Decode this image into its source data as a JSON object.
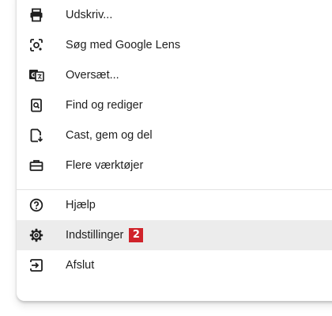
{
  "menu": {
    "top_items": [
      {
        "label": "Udskriv...",
        "icon": "print-icon"
      },
      {
        "label": "Søg med Google Lens",
        "icon": "google-lens-icon"
      },
      {
        "label": "Oversæt...",
        "icon": "translate-icon"
      },
      {
        "label": "Find og rediger",
        "icon": "find-edit-icon"
      },
      {
        "label": "Cast, gem og del",
        "icon": "cast-save-share-icon"
      },
      {
        "label": "Flere værktøjer",
        "icon": "toolbox-icon"
      }
    ],
    "bottom_items": [
      {
        "label": "Hjælp",
        "icon": "help-icon"
      },
      {
        "label": "Indstillinger",
        "icon": "gear-icon",
        "highlighted": true
      },
      {
        "label": "Afslut",
        "icon": "exit-icon"
      }
    ],
    "badge": "2",
    "badge_color": "#d0232b",
    "hover_color": "#ececec"
  }
}
